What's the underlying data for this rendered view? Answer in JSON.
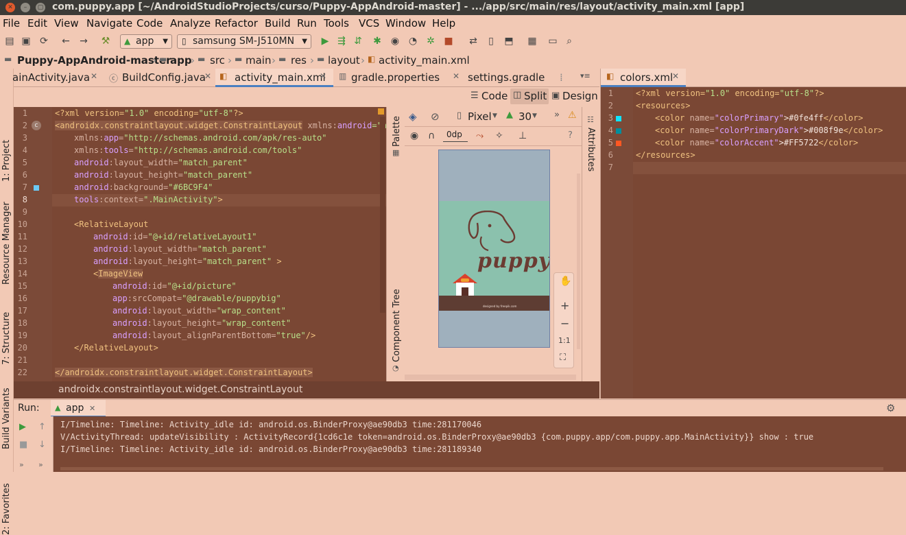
{
  "window": {
    "title": "com.puppy.app [~/AndroidStudioProjects/curso/Puppy-AppAndroid-master] - .../app/src/main/res/layout/activity_main.xml [app]"
  },
  "menu": [
    "File",
    "Edit",
    "View",
    "Navigate",
    "Code",
    "Analyze",
    "Refactor",
    "Build",
    "Run",
    "Tools",
    "VCS",
    "Window",
    "Help"
  ],
  "toolbar": {
    "config": "app",
    "device": "samsung SM-J510MN"
  },
  "breadcrumb": [
    "Puppy-AppAndroid-master",
    "app",
    "src",
    "main",
    "res",
    "layout",
    "activity_main.xml"
  ],
  "left_tools": [
    "1: Project",
    "Resource Manager",
    "7: Structure",
    "Build Variants",
    "2: Favorites"
  ],
  "tabs": [
    "ainActivity.java",
    "BuildConfig.java",
    "activity_main.xml",
    "gradle.properties",
    "settings.gradle"
  ],
  "view_modes": {
    "code": "Code",
    "split": "Split",
    "design": "Design"
  },
  "editor_lines": [
    {
      "n": "1"
    },
    {
      "n": "2"
    },
    {
      "n": "3"
    },
    {
      "n": "4"
    },
    {
      "n": "5"
    },
    {
      "n": "6"
    },
    {
      "n": "7"
    },
    {
      "n": "8"
    },
    {
      "n": "9"
    },
    {
      "n": "10"
    },
    {
      "n": "11"
    },
    {
      "n": "12"
    },
    {
      "n": "13"
    },
    {
      "n": "14"
    },
    {
      "n": "15"
    },
    {
      "n": "16"
    },
    {
      "n": "17"
    },
    {
      "n": "18"
    },
    {
      "n": "19"
    },
    {
      "n": "20"
    },
    {
      "n": "21"
    },
    {
      "n": "22"
    }
  ],
  "code": {
    "l1a": "<?xml version=",
    "l1b": "\"1.0\"",
    "l1c": " encoding=",
    "l1d": "\"utf-8\"",
    "l1e": "?>",
    "l2a": "<androidx.constraintlayout.widget.ConstraintLayout",
    "l2b": " xmlns:",
    "l2c": "android",
    "l2d": "=\"htt",
    "l3a": "xmlns:",
    "l3b": "app",
    "l3c": "=",
    "l3d": "\"http://schemas.android.com/apk/res-auto\"",
    "l4a": "xmlns:",
    "l4b": "tools",
    "l4c": "=",
    "l4d": "\"http://schemas.android.com/tools\"",
    "l5a": "android",
    "l5b": ":layout_width=",
    "l5c": "\"match_parent\"",
    "l6a": "android",
    "l6b": ":layout_height=",
    "l6c": "\"match_parent\"",
    "l7a": "android",
    "l7b": ":background=",
    "l7c": "\"#6BC9F4\"",
    "l8a": "tools",
    "l8b": ":context=",
    "l8c": "\".MainActivity\"",
    "l8d": ">",
    "l10": "<RelativeLayout",
    "l11a": "android",
    "l11b": ":id=",
    "l11c": "\"@+id/relativeLayout1\"",
    "l12a": "android",
    "l12b": ":layout_width=",
    "l12c": "\"match_parent\"",
    "l13a": "android",
    "l13b": ":layout_height=",
    "l13c": "\"match_parent\"",
    "l13d": " >",
    "l14a": "<",
    "l14b": "ImageView",
    "l15a": "android",
    "l15b": ":id=",
    "l15c": "\"@+id/picture\"",
    "l16a": "app",
    "l16b": ":srcCompat=",
    "l16c": "\"@drawable/puppybig\"",
    "l17a": "android",
    "l17b": ":layout_width=",
    "l17c": "\"wrap_content\"",
    "l18a": "android",
    "l18b": ":layout_height=",
    "l18c": "\"wrap_content\"",
    "l19a": "android",
    "l19b": ":layout_alignParentBottom=",
    "l19c": "\"true\"",
    "l19d": "/>",
    "l20": "</RelativeLayout>",
    "l22": "</androidx.constraintlayout.widget.ConstraintLayout>"
  },
  "status_crumb": "androidx.constraintlayout.widget.ConstraintLayout",
  "design": {
    "palette": "Palette",
    "component_tree": "Component Tree",
    "attributes": "Attributes",
    "device": "Pixel",
    "api": "30",
    "margin": "0dp",
    "zoom_fit": "1:1",
    "phone_brand": "puppy",
    "phone_footer": "designed by freepik.com"
  },
  "right": {
    "tab": "colors.xml",
    "lines": [
      {
        "n": "1"
      },
      {
        "n": "2"
      },
      {
        "n": "3"
      },
      {
        "n": "4"
      },
      {
        "n": "5"
      },
      {
        "n": "6"
      },
      {
        "n": "7"
      }
    ],
    "r1a": "<?xml version=",
    "r1b": "\"1.0\"",
    "r1c": " encoding=",
    "r1d": "\"utf-8\"",
    "r1e": "?>",
    "r2": "<resources>",
    "r3a": "<color",
    "r3b": " name=",
    "r3c": "\"colorPrimary\"",
    "r3d": ">#0fe4ff",
    "r3e": "</color>",
    "r4a": "<color",
    "r4b": " name=",
    "r4c": "\"colorPrimaryDark\"",
    "r4d": ">#008f9e",
    "r4e": "</color>",
    "r5a": "<color",
    "r5b": " name=",
    "r5c": "\"colorAccent\"",
    "r5d": ">#FF5722",
    "r5e": "</color>",
    "r6": "</resources>",
    "swatches": [
      "#0fe4ff",
      "#008f9e",
      "#FF5722"
    ]
  },
  "run": {
    "label": "Run:",
    "tab": "app",
    "lines": [
      "I/Timeline: Timeline: Activity_idle id: android.os.BinderProxy@ae90db3 time:281170046",
      "V/ActivityThread: updateVisibility : ActivityRecord{1cd6c1e token=android.os.BinderProxy@ae90db3 {com.puppy.app/com.puppy.app.MainActivity}} show : true",
      "I/Timeline: Timeline: Activity_idle id: android.os.BinderProxy@ae90db3 time:281189340"
    ]
  }
}
